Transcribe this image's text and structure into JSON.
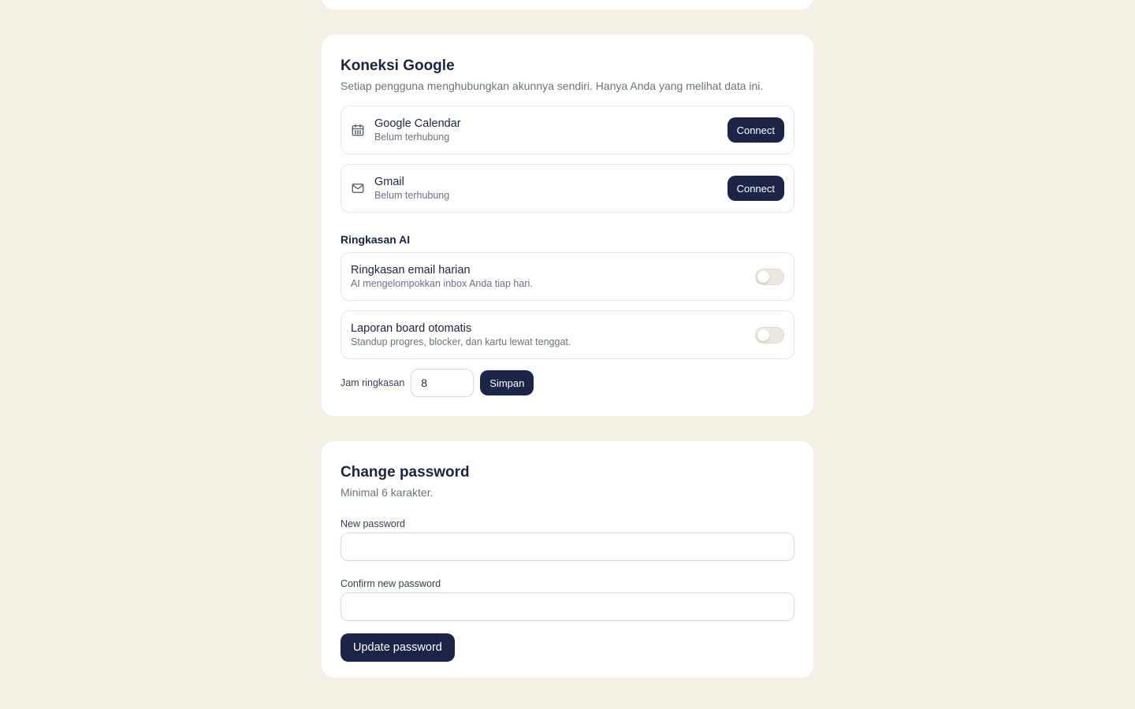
{
  "google": {
    "title": "Koneksi Google",
    "subtitle": "Setiap pengguna menghubungkan akunnya sendiri. Hanya Anda yang melihat data ini.",
    "services": [
      {
        "icon": "calendar-icon",
        "name": "Google Calendar",
        "status": "Belum terhubung",
        "action": "Connect"
      },
      {
        "icon": "mail-icon",
        "name": "Gmail",
        "status": "Belum terhubung",
        "action": "Connect"
      }
    ]
  },
  "ai": {
    "title": "Ringkasan AI",
    "options": [
      {
        "name": "Ringkasan email harian",
        "desc": "AI mengelompokkan inbox Anda tiap hari.",
        "enabled": false
      },
      {
        "name": "Laporan board otomatis",
        "desc": "Standup progres, blocker, dan kartu lewat tenggat.",
        "enabled": false
      }
    ],
    "jam_label": "Jam ringkasan",
    "jam_value": "8",
    "save_label": "Simpan"
  },
  "password": {
    "title": "Change password",
    "subtitle": "Minimal 6 karakter.",
    "new_label": "New password",
    "new_value": "",
    "confirm_label": "Confirm new password",
    "confirm_value": "",
    "submit_label": "Update password"
  },
  "colors": {
    "background": "#f5f0e6",
    "primary": "#1b2548",
    "card": "#ffffff"
  }
}
